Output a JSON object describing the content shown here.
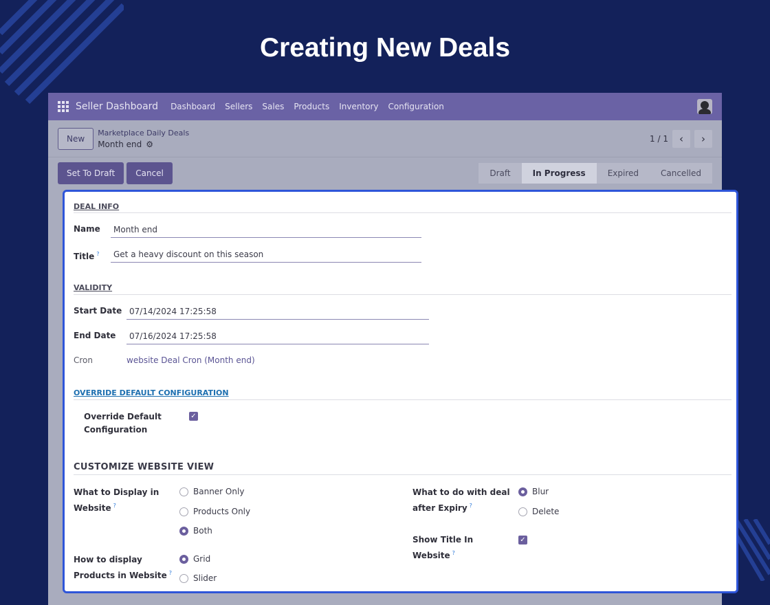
{
  "page_title": "Creating New Deals",
  "navbar": {
    "brand": "Seller Dashboard",
    "items": [
      "Dashboard",
      "Sellers",
      "Sales",
      "Products",
      "Inventory",
      "Configuration"
    ]
  },
  "controlbar": {
    "new_label": "New",
    "breadcrumb_parent": "Marketplace Daily Deals",
    "breadcrumb_current": "Month end",
    "pager": "1 / 1"
  },
  "statusbar": {
    "set_to_draft": "Set To Draft",
    "cancel": "Cancel",
    "stages": [
      "Draft",
      "In Progress",
      "Expired",
      "Cancelled"
    ],
    "active_stage": "In Progress"
  },
  "form": {
    "deal_info": {
      "title": "DEAL INFO",
      "name_label": "Name",
      "name_value": "Month end",
      "title_label": "Title",
      "title_help": "?",
      "title_value": "Get a heavy discount on this season"
    },
    "validity": {
      "title": "VALIDITY",
      "start_label": "Start Date",
      "start_value": "07/14/2024 17:25:58",
      "end_label": "End Date",
      "end_value": "07/16/2024 17:25:58",
      "cron_label": "Cron",
      "cron_value": "website Deal Cron (Month end)"
    },
    "override": {
      "title": "OVERRIDE DEFAULT CONFIGURATION",
      "label_line1": "Override Default",
      "label_line2": "Configuration",
      "checked": true
    },
    "customize": {
      "title": "CUSTOMIZE WEBSITE VIEW",
      "display_label_line1": "What to Display in",
      "display_label_line2": "Website",
      "display_help": "?",
      "display_options": [
        "Banner Only",
        "Products Only",
        "Both"
      ],
      "display_selected": "Both",
      "products_label_line1": "How to display",
      "products_label_line2": "Products in Website",
      "products_help": "?",
      "products_options": [
        "Grid",
        "Slider"
      ],
      "products_selected": "Grid",
      "expiry_label_line1": "What to do with deal",
      "expiry_label_line2": "after Expiry",
      "expiry_help": "?",
      "expiry_options": [
        "Blur",
        "Delete"
      ],
      "expiry_selected": "Blur",
      "show_title_label_line1": "Show Title In",
      "show_title_label_line2": "Website",
      "show_title_help": "?",
      "show_title_checked": true
    }
  },
  "colors": {
    "background": "#13215a",
    "navbar": "#6a62a5",
    "card_border": "#2e55d9",
    "accent": "#6b5f9e"
  }
}
